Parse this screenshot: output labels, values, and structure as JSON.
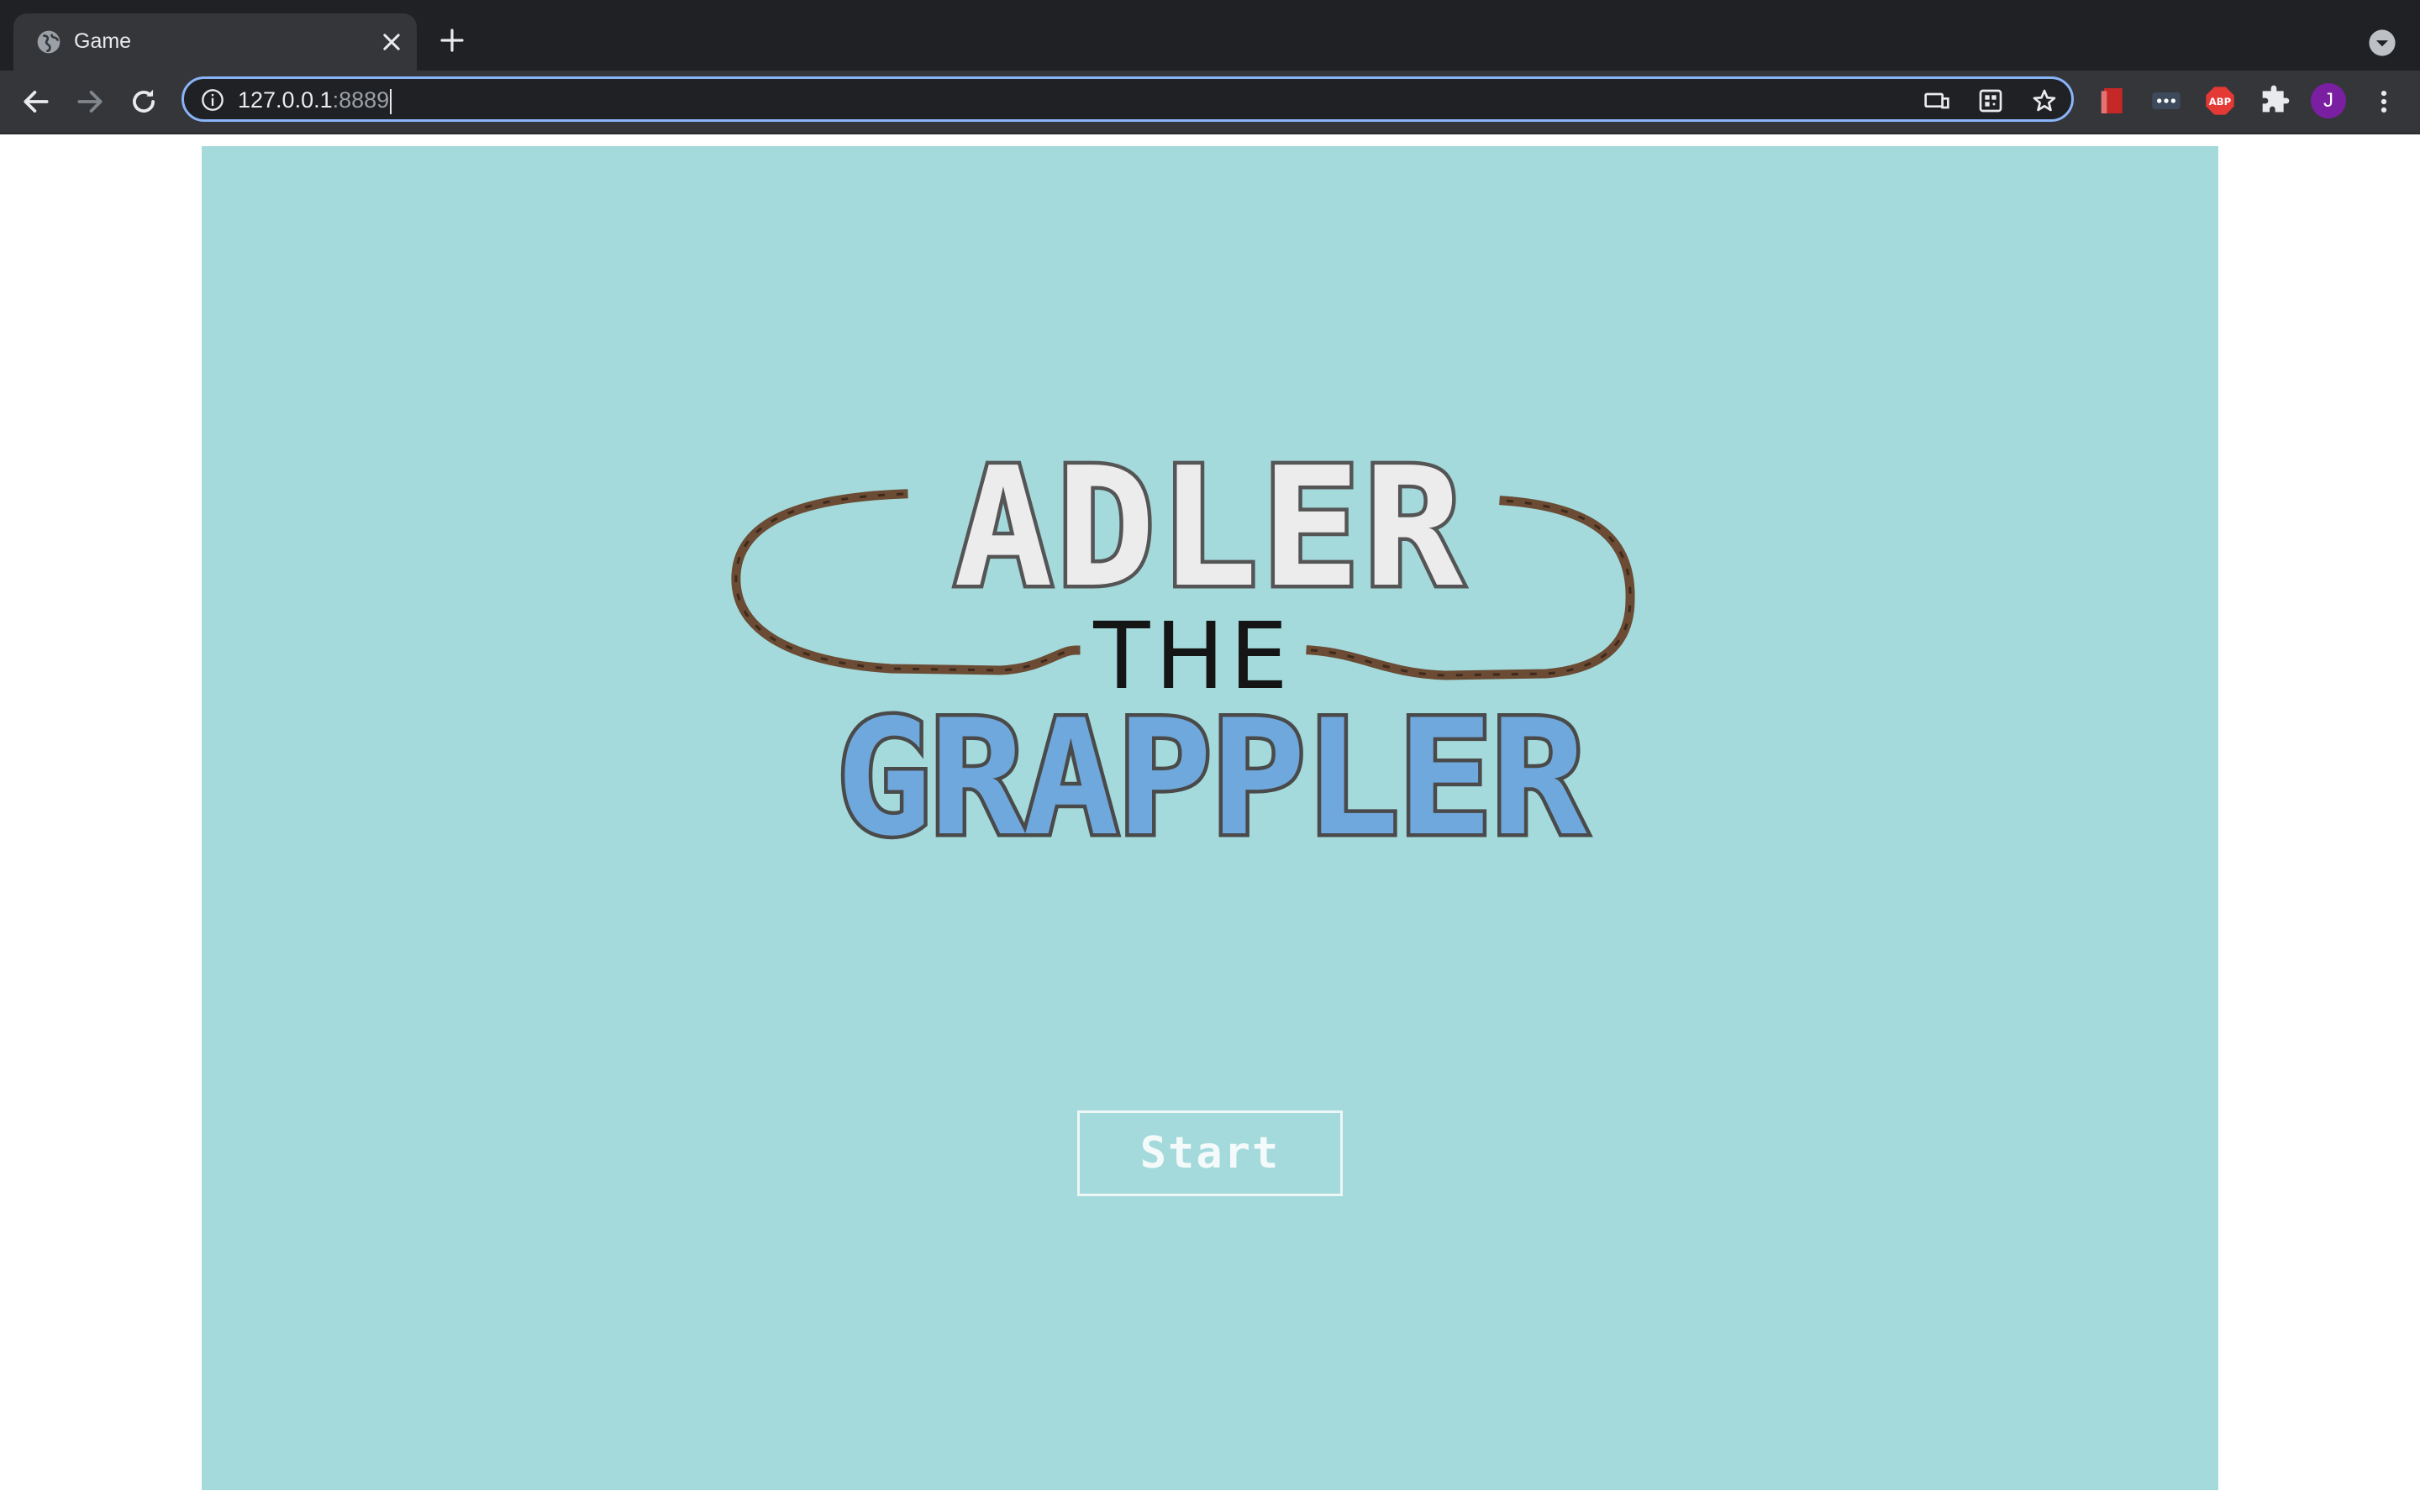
{
  "browser": {
    "tab": {
      "title": "Game",
      "favicon": "globe-icon"
    },
    "address_bar": {
      "host": "127.0.0.1",
      "port": ":8889"
    },
    "profile_initial": "J",
    "extensions": [
      "bookmark-extension-icon",
      "password-extension-icon",
      "adblock-extension-icon",
      "puzzle-extensions-icon"
    ]
  },
  "game": {
    "logo": {
      "line1": "ADLER",
      "line2": "THE",
      "line3": "GRAPPLER"
    },
    "start_button": {
      "label": "Start"
    }
  },
  "colors": {
    "game_background": "#a4dadc",
    "title_white": "#ececec",
    "title_blue": "#6fa8dc",
    "rope_brown": "#6b4b34"
  }
}
